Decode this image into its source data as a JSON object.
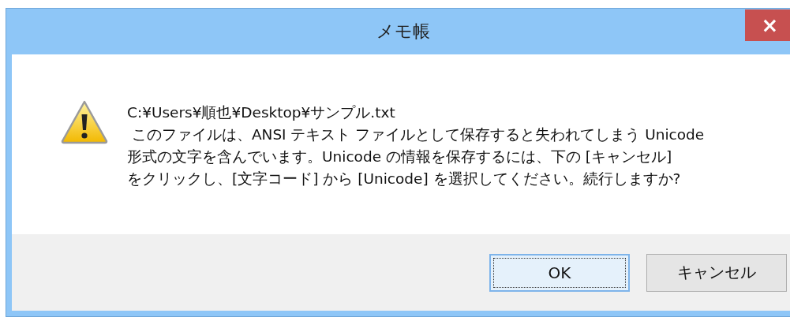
{
  "window": {
    "title": "メモ帳",
    "close": "×"
  },
  "message": {
    "path": "C:¥Users¥順也¥Desktop¥サンプル.txt",
    "lines": [
      " このファイルは、ANSI テキスト ファイルとして保存すると失われてしまう Unicode",
      "形式の文字を含んでいます。Unicode の情報を保存するには、下の [キャンセル]",
      "をクリックし、[文字コード] から [Unicode] を選択してください。続行しますか?"
    ]
  },
  "buttons": [
    {
      "label": "OK",
      "selected": true
    },
    {
      "label": "キャンセル",
      "selected": false
    }
  ]
}
